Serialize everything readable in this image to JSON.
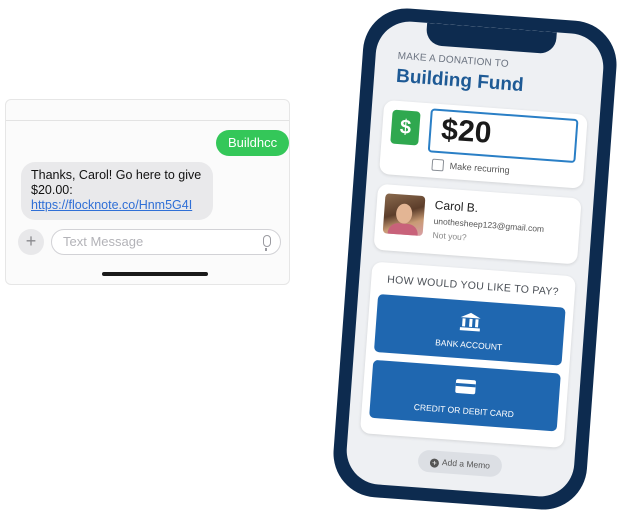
{
  "sms": {
    "outgoing_message": "Buildhcc",
    "incoming_text": "Thanks, Carol! Go here to give $20.00: ",
    "incoming_link": "https://flocknote.co/Hnm5G4I",
    "composer_placeholder": "Text Message",
    "plus_glyph": "+"
  },
  "donation": {
    "eyebrow": "MAKE A DONATION TO",
    "fund_name": "Building Fund",
    "currency_glyph": "$",
    "amount": "$20",
    "recurring_label": "Make recurring",
    "recurring_checked": false
  },
  "donor": {
    "name": "Carol B.",
    "email": "unothesheep123@gmail.com",
    "not_you": "Not you?"
  },
  "payment": {
    "heading": "HOW WOULD YOU LIKE TO PAY?",
    "options": [
      {
        "label": "BANK ACCOUNT",
        "icon": "bank-icon"
      },
      {
        "label": "CREDIT OR DEBIT CARD",
        "icon": "credit-card-icon"
      }
    ]
  },
  "memo": {
    "label": "Add a Memo",
    "plus_glyph": "+"
  },
  "colors": {
    "sms_outgoing": "#34c759",
    "phone_frame": "#0d2b4f",
    "title_blue": "#1e5a95",
    "pay_button": "#1f67b0",
    "dollar_badge": "#2fa84f"
  }
}
